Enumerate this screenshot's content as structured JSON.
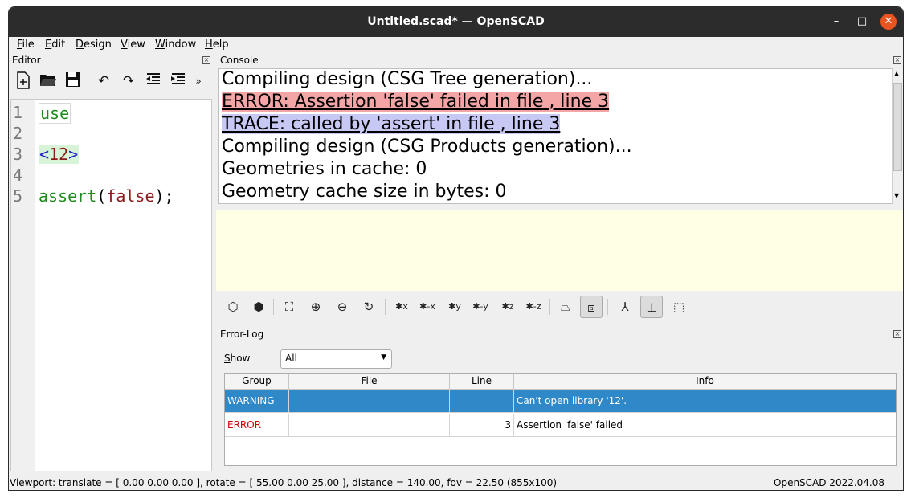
{
  "window": {
    "title": "Untitled.scad* — OpenSCAD",
    "minimize": "–",
    "maximize": "□",
    "close": "✕"
  },
  "menu": [
    {
      "label_accel": "F",
      "label_rest": "ile"
    },
    {
      "label_accel": "E",
      "label_rest": "dit"
    },
    {
      "label_accel": "D",
      "label_rest": "esign"
    },
    {
      "label_accel": "V",
      "label_rest": "iew"
    },
    {
      "label_accel": "W",
      "label_rest": "indow"
    },
    {
      "label_accel": "H",
      "label_rest": "elp"
    }
  ],
  "editor": {
    "title": "Editor",
    "toolbar": [
      "new-file-icon",
      "open-file-icon",
      "save-icon",
      "undo-icon",
      "redo-icon",
      "unindent-icon",
      "indent-icon",
      "more-icon"
    ],
    "lines": [
      {
        "num": "1",
        "text": "use"
      },
      {
        "num": "2",
        "text": ""
      },
      {
        "num": "3",
        "text": "<12>"
      },
      {
        "num": "4",
        "text": ""
      },
      {
        "num": "5",
        "text": "assert(false);",
        "parts": [
          "assert",
          "(",
          "false",
          ");"
        ]
      }
    ]
  },
  "console": {
    "title": "Console",
    "lines": [
      {
        "text": "Compiling design (CSG Tree generation)...",
        "kind": "normal"
      },
      {
        "text": "ERROR: Assertion 'false' failed in file , line 3",
        "kind": "error"
      },
      {
        "text": "TRACE: called by 'assert' in file , line 3",
        "kind": "trace"
      },
      {
        "text": "Compiling design (CSG Products generation)...",
        "kind": "normal"
      },
      {
        "text": "Geometries in cache: 0",
        "kind": "normal"
      },
      {
        "text": "Geometry cache size in bytes: 0",
        "kind": "normal"
      }
    ]
  },
  "view_toolbar": [
    "preview-icon",
    "render-icon",
    "view-all-icon",
    "zoom-in-icon",
    "zoom-out-icon",
    "reset-view-icon",
    "right-view-icon",
    "left-view-icon",
    "top-view-icon",
    "bottom-view-icon",
    "front-view-icon",
    "back-view-icon",
    "perspective-icon",
    "orthogonal-icon",
    "axes-icon",
    "scale-markers-icon",
    "edges-icon"
  ],
  "error_log": {
    "title": "Error-Log",
    "show_label_accel": "S",
    "show_label_rest": "how",
    "show_value": "All",
    "columns": [
      "Group",
      "File",
      "Line",
      "Info"
    ],
    "rows": [
      {
        "group": "WARNING",
        "file": "",
        "line": "",
        "info": "Can't open library '12'.",
        "selected": true
      },
      {
        "group": "ERROR",
        "file": "",
        "line": "3",
        "info": "Assertion 'false' failed",
        "selected": false
      }
    ]
  },
  "status": {
    "viewport": "Viewport: translate = [ 0.00 0.00 0.00 ], rotate = [ 55.00 0.00 25.00 ], distance = 140.00, fov = 22.50 (855x100)",
    "version": "OpenSCAD 2022.04.08"
  },
  "colors": {
    "error_bg": "#f4a6a6",
    "trace_bg": "#c8c8f4",
    "selected_row": "#2f88c8",
    "viewport_bg": "#ffffe5",
    "error_text": "#cc0000"
  }
}
